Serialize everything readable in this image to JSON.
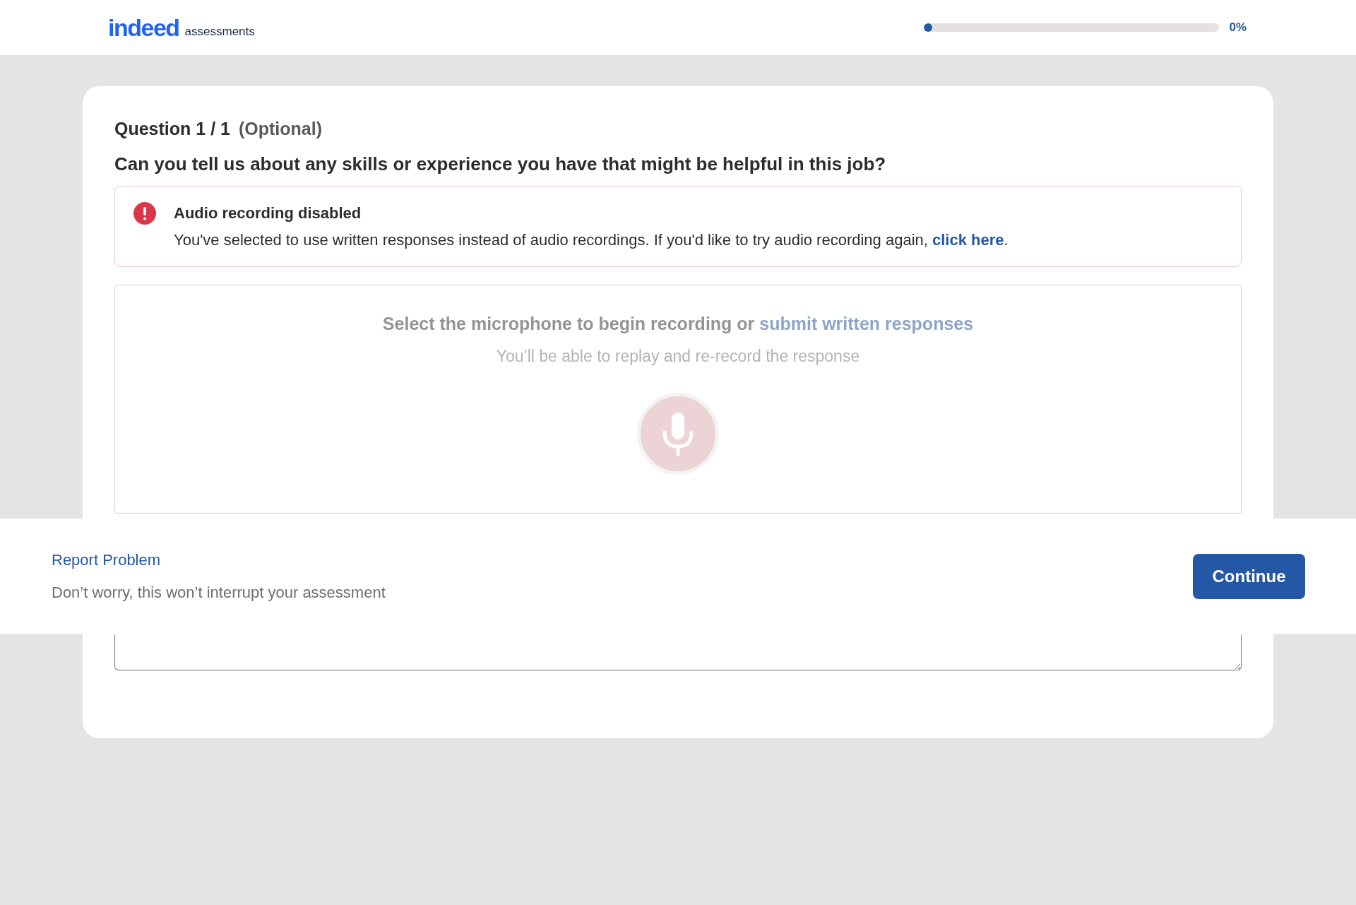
{
  "header": {
    "logo": {
      "brand": "indeed",
      "product": "assessments"
    },
    "progress": {
      "level": 0,
      "reading": "0%"
    }
  },
  "question": {
    "number": "Question 1 / 1",
    "optional": "(Optional)",
    "text": "Can you tell us about any skills or experience you have that might be helpful in this job?"
  },
  "alert": {
    "kind": "error",
    "title": "Audio recording disabled",
    "message_before": "You've selected to use written responses instead of audio recordings. If you'd like to try audio recording again, ",
    "link": "click here",
    "message_after": "."
  },
  "recorder": {
    "disabled": true,
    "prompt": "Select the microphone to begin recording or ",
    "link": "submit written responses",
    "hint": "You’ll be able to replay and re-record the response"
  },
  "footer": {
    "report_link": "Report Problem",
    "note": "Don’t worry, this won’t interrupt your assessment",
    "button": "Continue"
  }
}
